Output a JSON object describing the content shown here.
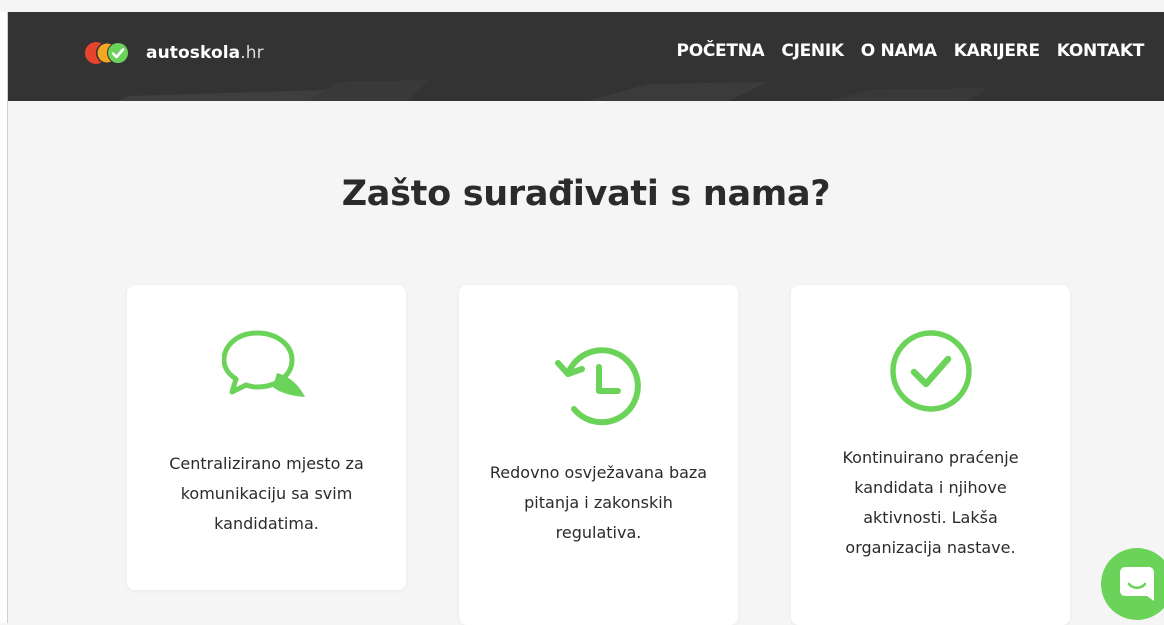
{
  "brand": {
    "name": "autoskola",
    "tld": ".hr"
  },
  "nav": {
    "items": [
      "POČETNA",
      "CJENIK",
      "O NAMA",
      "KARIJERE",
      "KONTAKT"
    ]
  },
  "section": {
    "title": "Zašto surađivati s nama?"
  },
  "features": [
    {
      "icon": "chat-bubbles-icon",
      "text": "Centralizirano mjesto za komunikaciju sa svim kandidatima."
    },
    {
      "icon": "history-clock-icon",
      "text": "Redovno osvježavana baza pitanja i zakonskih regulativa."
    },
    {
      "icon": "check-circle-icon",
      "text": "Kontinuirano praćenje kandidata i njihove aktivnosti. Lakša organizacija nastave."
    }
  ],
  "chat_widget": {
    "icon": "chat-icon"
  },
  "colors": {
    "accent": "#6cd35a",
    "navbar": "#333333",
    "background": "#f5f5f5",
    "logo_red": "#e8432b",
    "logo_orange": "#f5a623"
  }
}
